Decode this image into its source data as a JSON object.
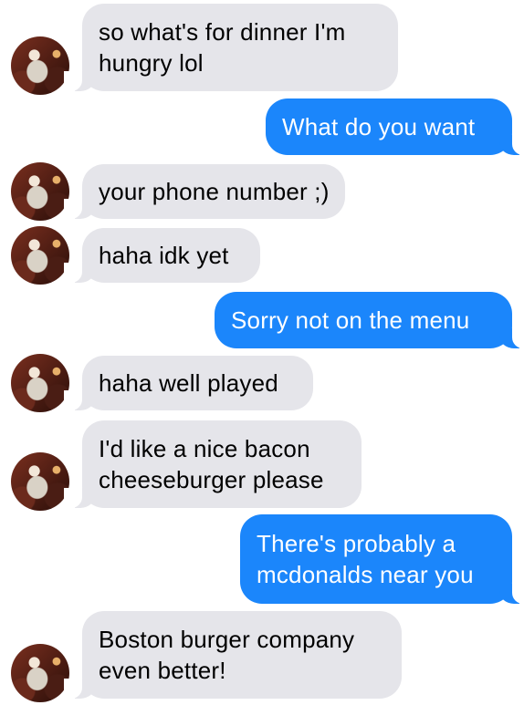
{
  "messages": [
    {
      "direction": "incoming",
      "lines": [
        "so what's for dinner I'm",
        "hungry lol"
      ]
    },
    {
      "direction": "outgoing",
      "lines": [
        "What do you want"
      ]
    },
    {
      "direction": "incoming",
      "lines": [
        "your phone number ;)"
      ]
    },
    {
      "direction": "incoming",
      "lines": [
        "haha idk yet"
      ]
    },
    {
      "direction": "outgoing",
      "lines": [
        "Sorry not on the menu"
      ]
    },
    {
      "direction": "incoming",
      "lines": [
        "haha well played"
      ]
    },
    {
      "direction": "incoming",
      "lines": [
        "I'd like a nice bacon",
        "cheeseburger please"
      ]
    },
    {
      "direction": "outgoing",
      "lines": [
        "There's probably a",
        "mcdonalds near you"
      ]
    },
    {
      "direction": "incoming",
      "lines": [
        "Boston burger company",
        "even better!"
      ]
    }
  ],
  "colors": {
    "incoming_bubble": "#e5e5ea",
    "outgoing_bubble": "#1b86fb",
    "incoming_text": "#000000",
    "outgoing_text": "#ffffff"
  }
}
